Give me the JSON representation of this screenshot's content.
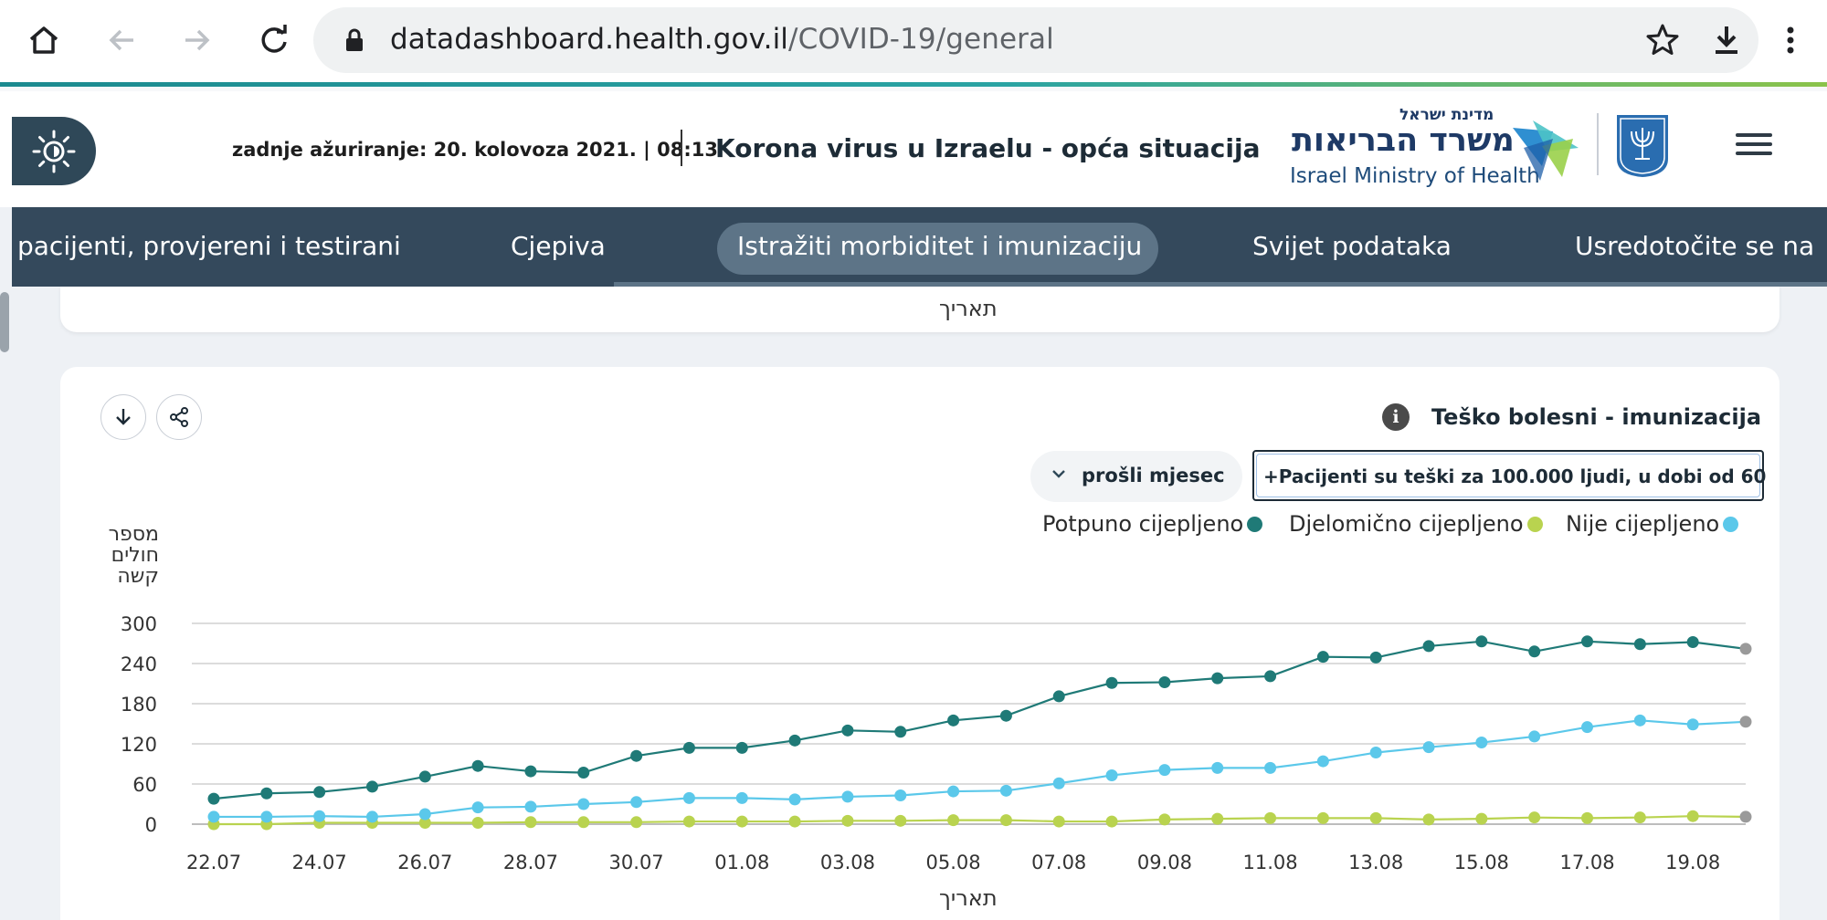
{
  "browser": {
    "url_domain": "datadashboard.health.gov.il",
    "url_path": "/COVID-19/general"
  },
  "header": {
    "updated": "zadnje ažuriranje: 20. kolovoza 2021. | 08:13",
    "title": "Korona virus u Izraelu - opća situacija",
    "ministry_hebrew_small": "מדינת ישראל",
    "ministry_hebrew": "משרד הבריאות",
    "ministry_english": "Israel Ministry of Health"
  },
  "nav": {
    "items": [
      "pacijenti, provjereni i testirani",
      "Cjepiva",
      "Istražiti morbiditet i imunizaciju",
      "Svijet podataka",
      "Usredotočite se na"
    ],
    "active_index": 2
  },
  "top_card": {
    "xlabel": "תאריך"
  },
  "card": {
    "title": "Teško bolesni - imunizacija",
    "period": "prošli mjesec",
    "metric": "+Pacijenti su teški za 100.000 ljudi, u dobi od 60"
  },
  "colors": {
    "fully": "#1f7a77",
    "partially": "#b9d34f",
    "not": "#5bc8ea",
    "pending": "#9a9a9a",
    "nav": "#34495c"
  },
  "chart_data": {
    "type": "line",
    "ylabel_lines": [
      "מספר",
      "חולים",
      "קשה"
    ],
    "xlabel": "תאריך",
    "ylim": [
      0,
      300
    ],
    "yticks": [
      0,
      60,
      120,
      180,
      240,
      300
    ],
    "x": [
      "22.07",
      "23.07",
      "24.07",
      "25.07",
      "26.07",
      "27.07",
      "28.07",
      "29.07",
      "30.07",
      "31.07",
      "01.08",
      "02.08",
      "03.08",
      "04.08",
      "05.08",
      "06.08",
      "07.08",
      "08.08",
      "09.08",
      "10.08",
      "11.08",
      "12.08",
      "13.08",
      "14.08",
      "15.08",
      "16.08",
      "17.08",
      "18.08",
      "19.08",
      "20.08"
    ],
    "xtick_labels": [
      "22.07",
      "24.07",
      "26.07",
      "28.07",
      "30.07",
      "01.08",
      "03.08",
      "05.08",
      "07.08",
      "09.08",
      "11.08",
      "13.08",
      "15.08",
      "17.08",
      "19.08"
    ],
    "legend": [
      "Potpuno cijepljeno",
      "Djelomično cijepljeno",
      "Nije cijepljeno"
    ],
    "series": [
      {
        "name": "Potpuno cijepljeno",
        "values": [
          38,
          46,
          48,
          56,
          71,
          87,
          79,
          77,
          102,
          114,
          114,
          125,
          140,
          138,
          155,
          162,
          191,
          211,
          212,
          218,
          221,
          250,
          249,
          266,
          273,
          258,
          273,
          269,
          272,
          262
        ]
      },
      {
        "name": "Djelomično cijepljeno",
        "values": [
          0,
          0,
          2,
          2,
          2,
          2,
          3,
          3,
          3,
          4,
          4,
          4,
          5,
          5,
          6,
          6,
          4,
          4,
          7,
          8,
          9,
          9,
          9,
          7,
          8,
          10,
          9,
          10,
          12,
          11
        ]
      },
      {
        "name": "Nije cijepljeno",
        "values": [
          11,
          11,
          12,
          11,
          15,
          25,
          26,
          30,
          33,
          39,
          39,
          37,
          41,
          43,
          49,
          50,
          61,
          73,
          81,
          84,
          84,
          94,
          107,
          115,
          122,
          131,
          145,
          155,
          149,
          153
        ]
      }
    ]
  }
}
